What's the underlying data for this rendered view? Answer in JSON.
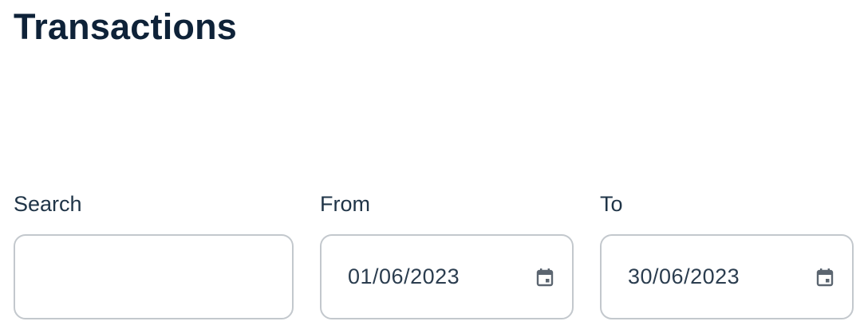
{
  "page": {
    "title": "Transactions"
  },
  "filters": {
    "search": {
      "label": "Search",
      "value": ""
    },
    "from": {
      "label": "From",
      "value": "01/06/2023",
      "icon": "calendar-icon"
    },
    "to": {
      "label": "To",
      "value": "30/06/2023",
      "icon": "calendar-icon"
    }
  },
  "colors": {
    "title": "#0e2238",
    "label": "#1f3447",
    "border": "#c3c8cd",
    "icon": "#5b6570"
  }
}
